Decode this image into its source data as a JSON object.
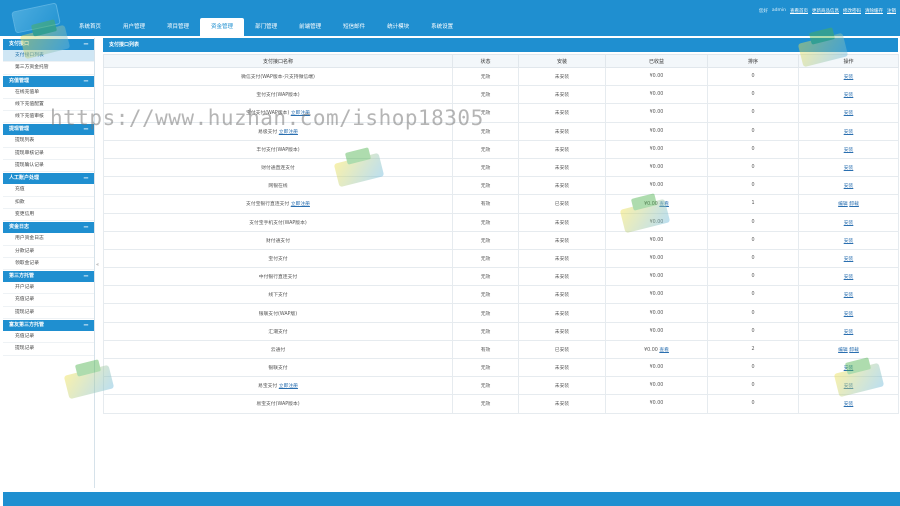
{
  "header": {
    "nav": [
      "系统首页",
      "用户管理",
      "项目管理",
      "资金管理",
      "部门管理",
      "前端管理",
      "短信邮件",
      "统计模块",
      "系统设置"
    ],
    "active_nav_index": 3,
    "user_label": "您好",
    "user_name": "admin",
    "links": [
      "查看首页",
      "更新商品信息",
      "修改密码",
      "清除缓存",
      "注销"
    ]
  },
  "sidebar": {
    "groups": [
      {
        "title": "支付接口",
        "items": [
          "支付接口列表",
          "第三方资金托管"
        ]
      },
      {
        "title": "充值管理",
        "items": [
          "在线充值单",
          "线下充值配置",
          "线下充值审核"
        ]
      },
      {
        "title": "提现管理",
        "items": [
          "提现列表",
          "提现审核记录",
          "提现确认记录"
        ]
      },
      {
        "title": "人工账户处理",
        "items": [
          "充值",
          "扣款",
          "变更信用"
        ]
      },
      {
        "title": "资金日志",
        "items": [
          "用户资金日志",
          "分款记录",
          "领取金记录"
        ]
      },
      {
        "title": "第三方托管",
        "items": [
          "开户记录",
          "充值记录",
          "提现记录"
        ]
      },
      {
        "title": "富友第三方托管",
        "items": [
          "充值记录",
          "提现记录"
        ]
      }
    ],
    "active_item": "支付接口列表",
    "toggle_glyph": "«"
  },
  "main": {
    "panel_title": "支付接口列表",
    "columns": [
      "支付接口名称",
      "状态",
      "安装",
      "已收益",
      "排序",
      "操作"
    ],
    "rows": [
      {
        "name": "微信支付(WAP版本-只支持微信端)",
        "name_link": "",
        "status": "无效",
        "install": "未安装",
        "balance": "¥0.00",
        "balance_link": "",
        "sort": "0",
        "ops": [
          "安装"
        ]
      },
      {
        "name": "宝付支付(WAP版本)",
        "name_link": "",
        "status": "无效",
        "install": "未安装",
        "balance": "¥0.00",
        "balance_link": "",
        "sort": "0",
        "ops": [
          "安装"
        ]
      },
      {
        "name": "宝付支付(WAP版本)",
        "name_link": "立即注册",
        "status": "无效",
        "install": "未安装",
        "balance": "¥0.00",
        "balance_link": "",
        "sort": "0",
        "ops": [
          "安装"
        ]
      },
      {
        "name": "易极支付",
        "name_link": "立即注册",
        "status": "无效",
        "install": "未安装",
        "balance": "¥0.00",
        "balance_link": "",
        "sort": "0",
        "ops": [
          "安装"
        ]
      },
      {
        "name": "丰付支付(WAP版本)",
        "name_link": "",
        "status": "无效",
        "install": "未安装",
        "balance": "¥0.00",
        "balance_link": "",
        "sort": "0",
        "ops": [
          "安装"
        ]
      },
      {
        "name": "财付通直连支付",
        "name_link": "",
        "status": "无效",
        "install": "未安装",
        "balance": "¥0.00",
        "balance_link": "",
        "sort": "0",
        "ops": [
          "安装"
        ]
      },
      {
        "name": "网银在线",
        "name_link": "",
        "status": "无效",
        "install": "未安装",
        "balance": "¥0.00",
        "balance_link": "",
        "sort": "0",
        "ops": [
          "安装"
        ]
      },
      {
        "name": "支付宝银行直连支付",
        "name_link": "立即注册",
        "status": "有效",
        "install": "已安装",
        "balance": "¥0.00",
        "balance_link": "查看",
        "sort": "1",
        "ops": [
          "编辑",
          "卸载"
        ]
      },
      {
        "name": "支付宝手机支付(WAP版本)",
        "name_link": "",
        "status": "无效",
        "install": "未安装",
        "balance": "¥0.00",
        "balance_link": "",
        "sort": "0",
        "ops": [
          "安装"
        ]
      },
      {
        "name": "财付通支付",
        "name_link": "",
        "status": "无效",
        "install": "未安装",
        "balance": "¥0.00",
        "balance_link": "",
        "sort": "0",
        "ops": [
          "安装"
        ]
      },
      {
        "name": "宝付支付",
        "name_link": "",
        "status": "无效",
        "install": "未安装",
        "balance": "¥0.00",
        "balance_link": "",
        "sort": "0",
        "ops": [
          "安装"
        ]
      },
      {
        "name": "中付银行直连支付",
        "name_link": "",
        "status": "无效",
        "install": "未安装",
        "balance": "¥0.00",
        "balance_link": "",
        "sort": "0",
        "ops": [
          "安装"
        ]
      },
      {
        "name": "线下支付",
        "name_link": "",
        "status": "无效",
        "install": "未安装",
        "balance": "¥0.00",
        "balance_link": "",
        "sort": "0",
        "ops": [
          "安装"
        ]
      },
      {
        "name": "银联支付(WAP版)",
        "name_link": "",
        "status": "无效",
        "install": "未安装",
        "balance": "¥0.00",
        "balance_link": "",
        "sort": "0",
        "ops": [
          "安装"
        ]
      },
      {
        "name": "汇潮支付",
        "name_link": "",
        "status": "无效",
        "install": "未安装",
        "balance": "¥0.00",
        "balance_link": "",
        "sort": "0",
        "ops": [
          "安装"
        ]
      },
      {
        "name": "云通付",
        "name_link": "",
        "status": "有效",
        "install": "已安装",
        "balance": "¥0.00",
        "balance_link": "查看",
        "sort": "2",
        "ops": [
          "编辑",
          "卸载"
        ]
      },
      {
        "name": "银联支付",
        "name_link": "",
        "status": "无效",
        "install": "未安装",
        "balance": "¥0.00",
        "balance_link": "",
        "sort": "0",
        "ops": [
          "安装"
        ]
      },
      {
        "name": "易宝支付",
        "name_link": "立即注册",
        "status": "无效",
        "install": "未安装",
        "balance": "¥0.00",
        "balance_link": "",
        "sort": "0",
        "ops": [
          "安装"
        ]
      },
      {
        "name": "易宝支付(WAP版本)",
        "name_link": "",
        "status": "无效",
        "install": "未安装",
        "balance": "¥0.00",
        "balance_link": "",
        "sort": "0",
        "ops": [
          "安装"
        ]
      }
    ]
  },
  "watermark": {
    "text": "https://www.huzhan.com/ishop18305"
  }
}
